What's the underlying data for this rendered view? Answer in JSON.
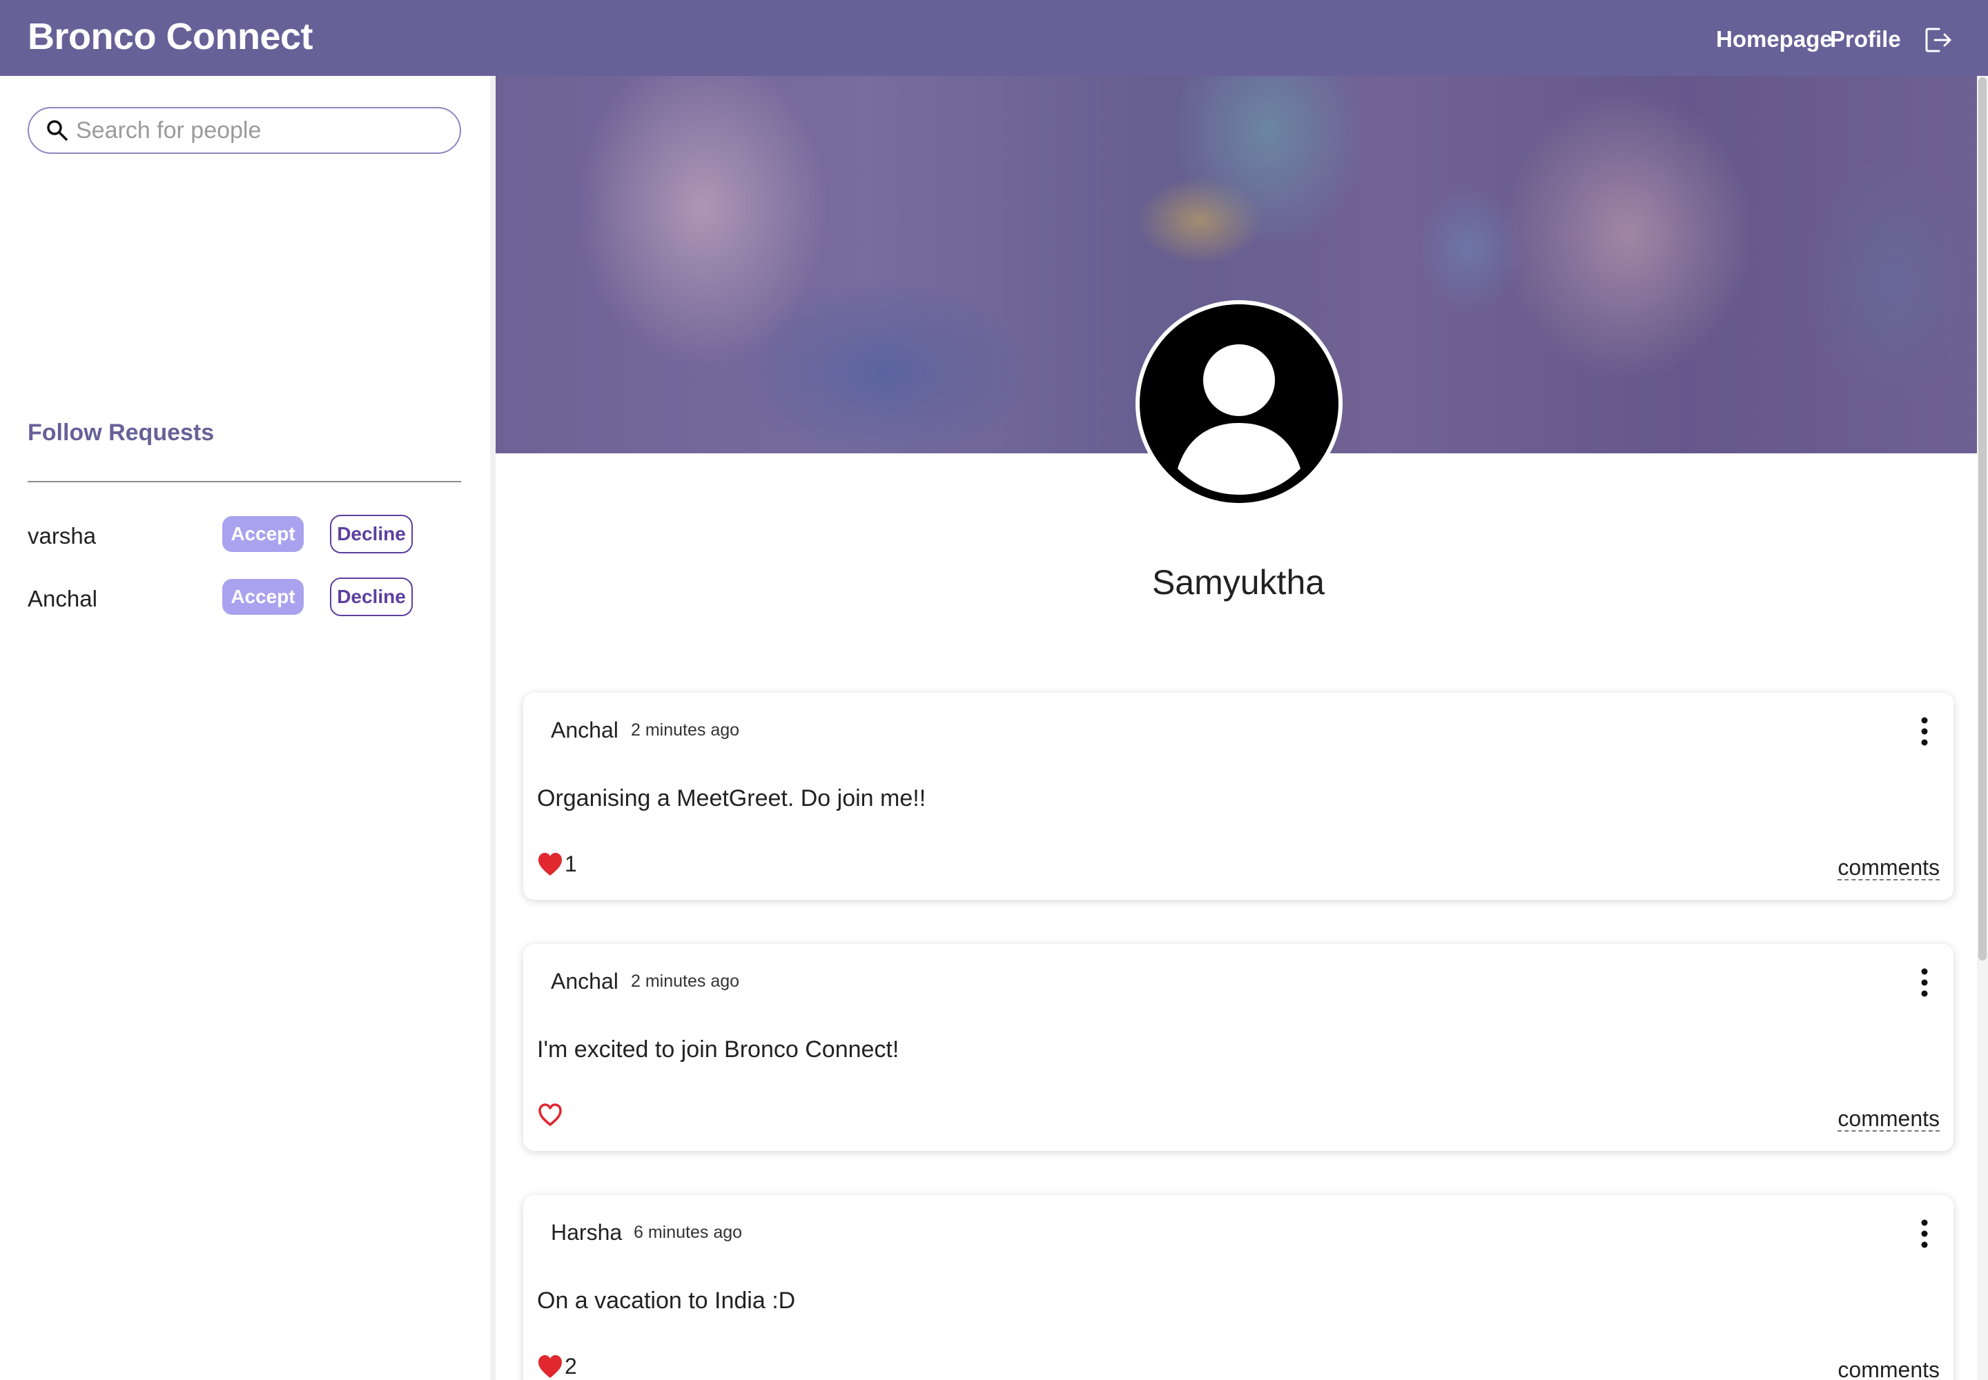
{
  "header": {
    "brand": "Bronco Connect",
    "nav": {
      "homepage": "Homepage",
      "profile": "Profile",
      "logout_icon": "logout-icon"
    },
    "background_color": "#676198"
  },
  "sidebar": {
    "search": {
      "placeholder": "Search for people",
      "value": "",
      "icon": "search-icon"
    },
    "follow_requests": {
      "title": "Follow Requests",
      "accept_label": "Accept",
      "decline_label": "Decline",
      "requests": [
        {
          "name": "varsha"
        },
        {
          "name": "Anchal"
        }
      ]
    }
  },
  "profile": {
    "name": "Samyuktha",
    "avatar_icon": "user-avatar-icon"
  },
  "posts": [
    {
      "author": "Anchal",
      "time": "2 minutes ago",
      "text": "Organising a MeetGreet. Do join me!!",
      "liked": true,
      "likes": "1",
      "comments_label": "comments"
    },
    {
      "author": "Anchal",
      "time": "2 minutes ago",
      "text": "I'm excited to join Bronco Connect!",
      "liked": false,
      "likes": "",
      "comments_label": "comments"
    },
    {
      "author": "Harsha",
      "time": "6 minutes ago",
      "text": "On a vacation to India :D",
      "liked": true,
      "likes": "2",
      "comments_label": "comments"
    }
  ],
  "colors": {
    "accent": "#676198",
    "accept_button": "#a9a2ee",
    "decline_border": "#5b3f9e",
    "heart": "#e0282e"
  }
}
